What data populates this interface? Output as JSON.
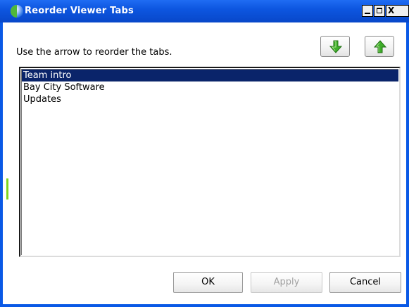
{
  "window": {
    "title": "Reorder Viewer Tabs",
    "accent_color": "#0a59e6",
    "controls": {
      "minimize_icon": "minimize-icon",
      "maximize_icon": "maximize-icon",
      "close_label": "X"
    }
  },
  "instruction": "Use the arrow to reorder the tabs.",
  "arrows": {
    "down_icon": "arrow-down-icon",
    "up_icon": "arrow-up-icon",
    "color": "#3fae2a"
  },
  "tab_list": {
    "selected_index": 0,
    "selection_color": "#0a246a",
    "items": [
      {
        "label": "Team intro"
      },
      {
        "label": "Bay City Software"
      },
      {
        "label": "Updates"
      }
    ]
  },
  "buttons": {
    "ok": "OK",
    "apply": "Apply",
    "cancel": "Cancel"
  }
}
